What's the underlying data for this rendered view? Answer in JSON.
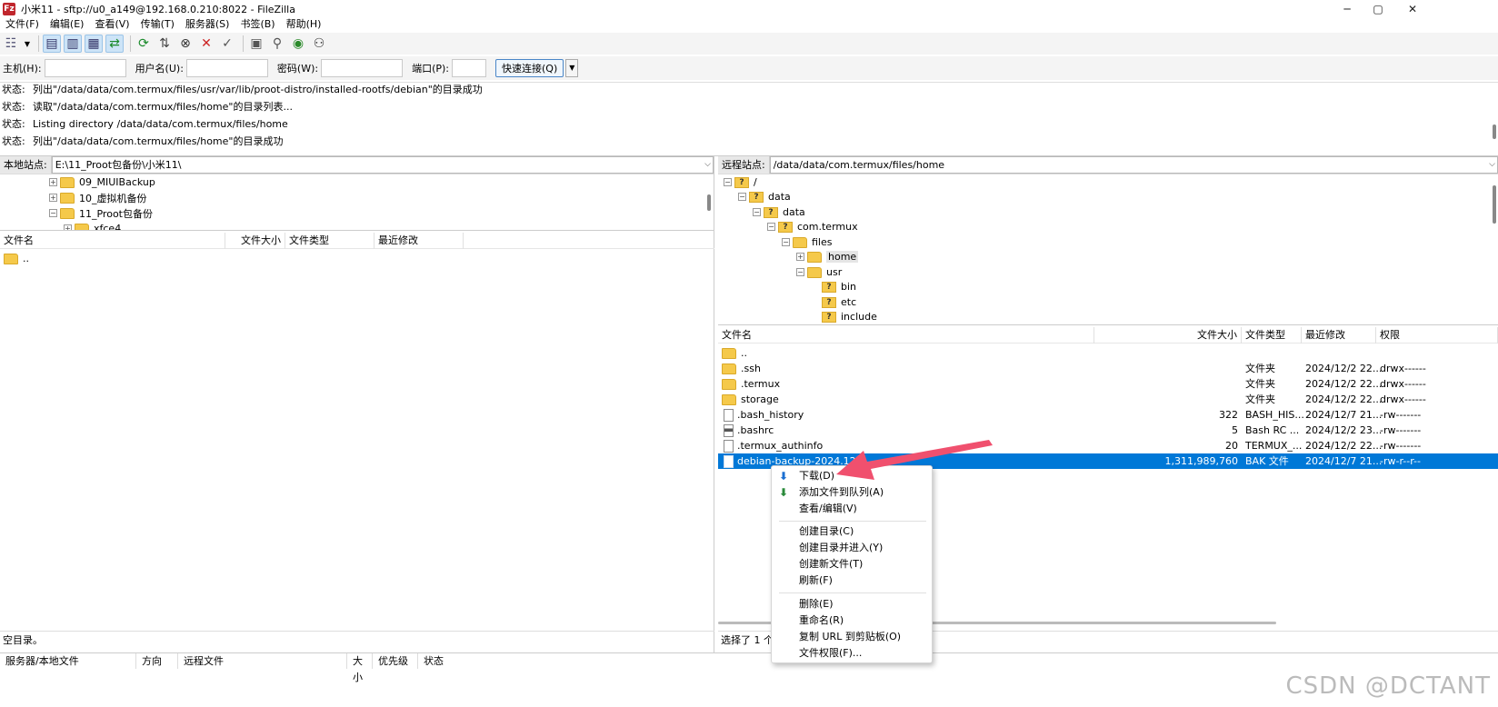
{
  "window": {
    "title": "小米11 - sftp://u0_a149@192.168.0.210:8022 - FileZilla",
    "app_icon": "Fz",
    "minimize": "─",
    "maximize": "▢",
    "close": "✕"
  },
  "menu": [
    "文件(F)",
    "编辑(E)",
    "查看(V)",
    "传输(T)",
    "服务器(S)",
    "书签(B)",
    "帮助(H)"
  ],
  "quickconnect": {
    "host_label": "主机(H):",
    "user_label": "用户名(U):",
    "pass_label": "密码(W):",
    "port_label": "端口(P):",
    "button": "快速连接(Q)",
    "dropdown": "▼"
  },
  "log": [
    {
      "label": "状态:",
      "text": "列出\"/data/data/com.termux/files/usr/var/lib/proot-distro/installed-rootfs/debian\"的目录成功"
    },
    {
      "label": "状态:",
      "text": "读取\"/data/data/com.termux/files/home\"的目录列表..."
    },
    {
      "label": "状态:",
      "text": "Listing directory /data/data/com.termux/files/home"
    },
    {
      "label": "状态:",
      "text": "列出\"/data/data/com.termux/files/home\"的目录成功"
    }
  ],
  "local": {
    "site_label": "本地站点:",
    "path": "E:\\11_Proot包备份\\小米11\\",
    "tree": [
      {
        "label": "09_MIUIBackup",
        "exp": "+"
      },
      {
        "label": "10_虚拟机备份",
        "exp": "+"
      },
      {
        "label": "11_Proot包备份",
        "exp": "−"
      },
      {
        "label": "xfce4",
        "exp": "+"
      }
    ],
    "columns": [
      "文件名",
      "文件大小",
      "文件类型",
      "最近修改"
    ],
    "files": [
      ".."
    ],
    "status": "空目录。"
  },
  "remote": {
    "site_label": "远程站点:",
    "path": "/data/data/com.termux/files/home",
    "tree": [
      {
        "label": "/",
        "icon": "q",
        "exp": "−"
      },
      {
        "label": "data",
        "icon": "q",
        "exp": "−"
      },
      {
        "label": "data",
        "icon": "q",
        "exp": "−"
      },
      {
        "label": "com.termux",
        "icon": "q",
        "exp": "−"
      },
      {
        "label": "files",
        "icon": "f",
        "exp": "−"
      },
      {
        "label": "home",
        "icon": "f",
        "exp": "+"
      },
      {
        "label": "usr",
        "icon": "f",
        "exp": "−"
      },
      {
        "label": "bin",
        "icon": "q",
        "exp": ""
      },
      {
        "label": "etc",
        "icon": "q",
        "exp": ""
      },
      {
        "label": "include",
        "icon": "q",
        "exp": ""
      }
    ],
    "columns": [
      "文件名",
      "文件大小",
      "文件类型",
      "最近修改",
      "权限"
    ],
    "files": [
      {
        "name": "..",
        "size": "",
        "type": "",
        "modified": "",
        "perm": "",
        "icon": "folder"
      },
      {
        "name": ".ssh",
        "size": "",
        "type": "文件夹",
        "modified": "2024/12/2 22...",
        "perm": "drwx------",
        "icon": "folder"
      },
      {
        "name": ".termux",
        "size": "",
        "type": "文件夹",
        "modified": "2024/12/2 22...",
        "perm": "drwx------",
        "icon": "folder"
      },
      {
        "name": "storage",
        "size": "",
        "type": "文件夹",
        "modified": "2024/12/2 22...",
        "perm": "drwx------",
        "icon": "folder"
      },
      {
        "name": ".bash_history",
        "size": "322",
        "type": "BASH_HIS...",
        "modified": "2024/12/7 21...",
        "perm": "-rw-------",
        "icon": "file"
      },
      {
        "name": ".bashrc",
        "size": "5",
        "type": "Bash RC ...",
        "modified": "2024/12/2 23...",
        "perm": "-rw-------",
        "icon": "cfg"
      },
      {
        "name": ".termux_authinfo",
        "size": "20",
        "type": "TERMUX_...",
        "modified": "2024/12/2 22...",
        "perm": "-rw-------",
        "icon": "file"
      },
      {
        "name": "debian-backup-2024.12.7",
        "size": "1,311,989,760",
        "type": "BAK 文件",
        "modified": "2024/12/7 21...",
        "perm": "-rw-r--r--",
        "icon": "file"
      }
    ],
    "status": "选择了 1 个文"
  },
  "context_menu": [
    {
      "label": "下载(D)",
      "icon": "download-icon"
    },
    {
      "label": "添加文件到队列(A)",
      "icon": "add-queue-icon"
    },
    {
      "label": "查看/编辑(V)"
    },
    {
      "sep": true
    },
    {
      "label": "创建目录(C)"
    },
    {
      "label": "创建目录并进入(Y)"
    },
    {
      "label": "创建新文件(T)"
    },
    {
      "label": "刷新(F)"
    },
    {
      "sep": true
    },
    {
      "label": "删除(E)"
    },
    {
      "label": "重命名(R)"
    },
    {
      "label": "复制 URL 到剪贴板(O)"
    },
    {
      "label": "文件权限(F)..."
    }
  ],
  "queue": {
    "columns": [
      "服务器/本地文件",
      "方向",
      "远程文件",
      "大小",
      "优先级",
      "状态"
    ]
  },
  "watermark": "CSDN @DCTANT",
  "colors": {
    "selection": "#0078d7",
    "arrow": "#f0506e"
  }
}
